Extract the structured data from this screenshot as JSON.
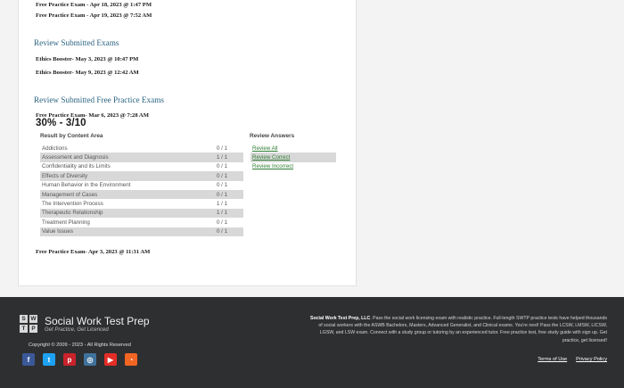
{
  "top_exams": [
    "Free Practice Exam - Apr 18, 2023 @ 1:47 PM",
    "Free Practice Exam - Apr 19, 2023 @ 7:52 AM"
  ],
  "review_submitted": {
    "title": "Review Submitted Exams",
    "exams": [
      "Ethics Booster- May 3, 2023 @ 10:47 PM",
      "Ethics Booster- May 9, 2023 @ 12:42 AM"
    ]
  },
  "review_free": {
    "title": "Review Submitted Free Practice Exams",
    "exam_title": "Free Practice Exam- Mar 6, 2023 @ 7:28 AM",
    "score": "30% - 3/10",
    "results_header": "Result by Content Area",
    "answers_header": "Review Answers",
    "results": [
      {
        "topic": "Addictions",
        "score": "0 / 1"
      },
      {
        "topic": "Assessment and Diagnosis",
        "score": "1 / 1"
      },
      {
        "topic": "Confidentiality and its Limits",
        "score": "0 / 1"
      },
      {
        "topic": "Effects of Diversity",
        "score": "0 / 1"
      },
      {
        "topic": "Human Behavior in the Environment",
        "score": "0 / 1"
      },
      {
        "topic": "Management of Cases",
        "score": "0 / 1"
      },
      {
        "topic": "The Intervention Process",
        "score": "1 / 1"
      },
      {
        "topic": "Therapeutic Relationship",
        "score": "1 / 1"
      },
      {
        "topic": "Treatment Planning",
        "score": "0 / 1"
      },
      {
        "topic": "Value Issues",
        "score": "0 / 1"
      }
    ],
    "answer_links": [
      "Review All",
      "Review Correct",
      "Review Incorrect"
    ],
    "next_exam": "Free Practice Exam- Apr 3, 2023 @ 11:31 AM"
  },
  "footer": {
    "logo_letters": [
      "S",
      "W",
      "T",
      "P"
    ],
    "brand": "Social Work Test Prep",
    "tagline": "Get Practice, Get Licenced",
    "copyright": "Copyright © 2009 - 2023 - All Rights Reserved",
    "about_bold": "Social Work Test Prep, LLC",
    "about_text": ". Pass the social work licensing exam with realistic practice. Full-length SWTP practice tests have helped thousands of social workers with the ASWB Bachelors, Masters, Advanced Generalist, and Clinical exams. You're next! Pass the LCSW, LMSW, LICSW, LGSW, and LSW exam. Connect with a study group or tutoring by an experienced tutor. Free practice test, free study guide with sign up. Get practice, get licensed!",
    "links": [
      "Terms of Use",
      "Privacy Policy"
    ],
    "socials": [
      {
        "name": "facebook-icon",
        "color": "#3b5998",
        "glyph": "f"
      },
      {
        "name": "twitter-icon",
        "color": "#1da1f2",
        "glyph": "t"
      },
      {
        "name": "pinterest-icon",
        "color": "#c8232c",
        "glyph": "p"
      },
      {
        "name": "instagram-icon",
        "color": "#3f729b",
        "glyph": "◎"
      },
      {
        "name": "youtube-icon",
        "color": "#e52d27",
        "glyph": "▶"
      },
      {
        "name": "rss-icon",
        "color": "#f26522",
        "glyph": "◔"
      }
    ]
  }
}
